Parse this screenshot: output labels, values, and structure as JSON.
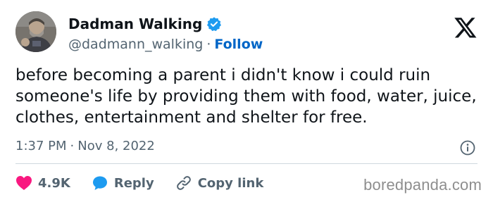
{
  "author": {
    "display_name": "Dadman Walking",
    "handle": "@dadmann_walking",
    "separator": "·",
    "follow_label": "Follow"
  },
  "tweet": {
    "text": "before becoming a parent i didn't know i could ruin someone's life by providing them with food, water, juice, clothes, entertainment and shelter for free.",
    "time": "1:37 PM",
    "separator": "·",
    "date": "Nov 8, 2022"
  },
  "actions": {
    "likes": "4.9K",
    "reply_label": "Reply",
    "copy_link_label": "Copy link"
  },
  "watermark": "boredpanda.com",
  "colors": {
    "verified": "#1d9bf0",
    "like_heart": "#f91880",
    "reply_bubble": "#1d9bf0",
    "follow": "#0066c7",
    "muted_text": "#536471"
  },
  "icons": [
    "verified-badge-icon",
    "x-logo-icon",
    "info-icon",
    "heart-icon",
    "reply-icon",
    "link-icon"
  ]
}
